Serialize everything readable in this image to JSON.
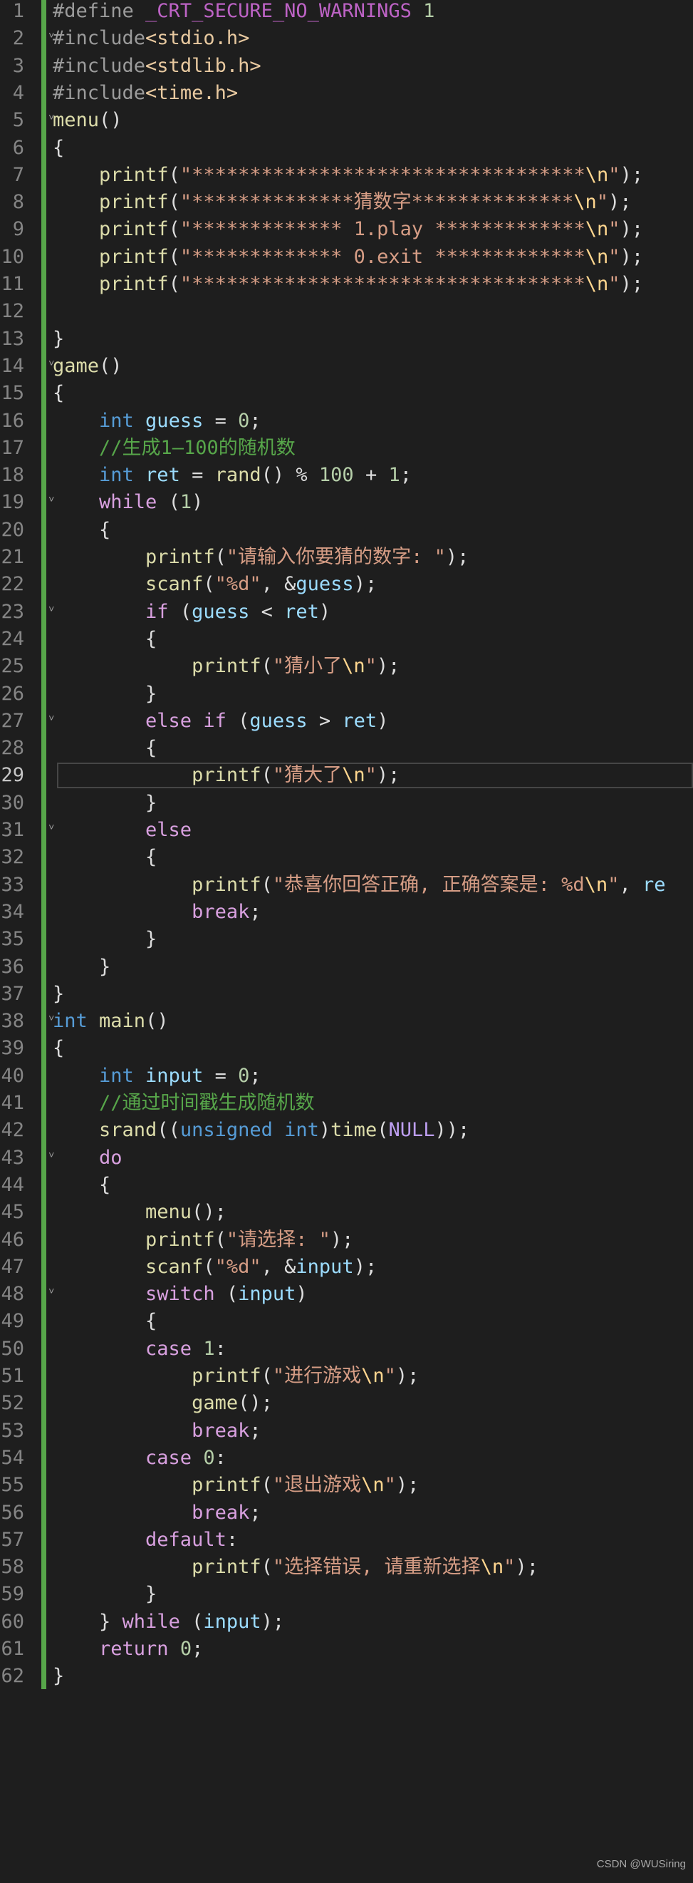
{
  "editor": {
    "current_line": 29,
    "lines": [
      [
        [
          "t-pp",
          "#define "
        ],
        [
          "t-macro",
          "_CRT_SECURE_NO_WARNINGS"
        ],
        [
          "t-num",
          " 1"
        ]
      ],
      [
        [
          "t-pp",
          "#include"
        ],
        [
          "t-inc",
          "<stdio.h>"
        ]
      ],
      [
        [
          "t-pp",
          "#include"
        ],
        [
          "t-inc",
          "<stdlib.h>"
        ]
      ],
      [
        [
          "t-pp",
          "#include"
        ],
        [
          "t-inc",
          "<time.h>"
        ]
      ],
      [
        [
          "t-fn",
          "menu"
        ],
        [
          "t-punc",
          "()"
        ]
      ],
      [
        [
          "t-punc",
          "{"
        ]
      ],
      [
        [
          "t-fn",
          "    printf"
        ],
        [
          "t-punc",
          "("
        ],
        [
          "t-str",
          "\"**********************************"
        ],
        [
          "t-esc",
          "\\n"
        ],
        [
          "t-str",
          "\""
        ],
        [
          "t-punc",
          ");"
        ]
      ],
      [
        [
          "t-fn",
          "    printf"
        ],
        [
          "t-punc",
          "("
        ],
        [
          "t-str",
          "\"**************猜数字**************"
        ],
        [
          "t-esc",
          "\\n"
        ],
        [
          "t-str",
          "\""
        ],
        [
          "t-punc",
          ");"
        ]
      ],
      [
        [
          "t-fn",
          "    printf"
        ],
        [
          "t-punc",
          "("
        ],
        [
          "t-str",
          "\"************* 1.play *************"
        ],
        [
          "t-esc",
          "\\n"
        ],
        [
          "t-str",
          "\""
        ],
        [
          "t-punc",
          ");"
        ]
      ],
      [
        [
          "t-fn",
          "    printf"
        ],
        [
          "t-punc",
          "("
        ],
        [
          "t-str",
          "\"************* 0.exit *************"
        ],
        [
          "t-esc",
          "\\n"
        ],
        [
          "t-str",
          "\""
        ],
        [
          "t-punc",
          ");"
        ]
      ],
      [
        [
          "t-fn",
          "    printf"
        ],
        [
          "t-punc",
          "("
        ],
        [
          "t-str",
          "\"**********************************"
        ],
        [
          "t-esc",
          "\\n"
        ],
        [
          "t-str",
          "\""
        ],
        [
          "t-punc",
          ");"
        ]
      ],
      [],
      [
        [
          "t-punc",
          "}"
        ]
      ],
      [
        [
          "t-fn",
          "game"
        ],
        [
          "t-punc",
          "()"
        ]
      ],
      [
        [
          "t-punc",
          "{"
        ]
      ],
      [
        [
          "t-kw",
          "    int"
        ],
        [
          "t-var",
          " guess"
        ],
        [
          "t-punc",
          " = "
        ],
        [
          "t-num",
          "0"
        ],
        [
          "t-punc",
          ";"
        ]
      ],
      [
        [
          "t-cmt",
          "    //生成1—100的随机数"
        ]
      ],
      [
        [
          "t-kw",
          "    int"
        ],
        [
          "t-var",
          " ret"
        ],
        [
          "t-punc",
          " = "
        ],
        [
          "t-fn",
          "rand"
        ],
        [
          "t-punc",
          "() % "
        ],
        [
          "t-num",
          "100"
        ],
        [
          "t-punc",
          " + "
        ],
        [
          "t-num",
          "1"
        ],
        [
          "t-punc",
          ";"
        ]
      ],
      [
        [
          "t-ctrl",
          "    while"
        ],
        [
          "t-punc",
          " ("
        ],
        [
          "t-num",
          "1"
        ],
        [
          "t-punc",
          ")"
        ]
      ],
      [
        [
          "t-punc",
          "    {"
        ]
      ],
      [
        [
          "t-fn",
          "        printf"
        ],
        [
          "t-punc",
          "("
        ],
        [
          "t-str",
          "\"请输入你要猜的数字: \""
        ],
        [
          "t-punc",
          ");"
        ]
      ],
      [
        [
          "t-fn",
          "        scanf"
        ],
        [
          "t-punc",
          "("
        ],
        [
          "t-str",
          "\"%d\""
        ],
        [
          "t-punc",
          ", &"
        ],
        [
          "t-var",
          "guess"
        ],
        [
          "t-punc",
          ");"
        ]
      ],
      [
        [
          "t-ctrl",
          "        if"
        ],
        [
          "t-punc",
          " ("
        ],
        [
          "t-var",
          "guess"
        ],
        [
          "t-punc",
          " < "
        ],
        [
          "t-var",
          "ret"
        ],
        [
          "t-punc",
          ")"
        ]
      ],
      [
        [
          "t-punc",
          "        {"
        ]
      ],
      [
        [
          "t-fn",
          "            printf"
        ],
        [
          "t-punc",
          "("
        ],
        [
          "t-str",
          "\"猜小了"
        ],
        [
          "t-esc",
          "\\n"
        ],
        [
          "t-str",
          "\""
        ],
        [
          "t-punc",
          ");"
        ]
      ],
      [
        [
          "t-punc",
          "        }"
        ]
      ],
      [
        [
          "t-ctrl",
          "        else if"
        ],
        [
          "t-punc",
          " ("
        ],
        [
          "t-var",
          "guess"
        ],
        [
          "t-punc",
          " > "
        ],
        [
          "t-var",
          "ret"
        ],
        [
          "t-punc",
          ")"
        ]
      ],
      [
        [
          "t-punc",
          "        {"
        ]
      ],
      [
        [
          "t-fn",
          "            printf"
        ],
        [
          "t-punc",
          "("
        ],
        [
          "t-str",
          "\"猜大了"
        ],
        [
          "t-esc",
          "\\n"
        ],
        [
          "t-str",
          "\""
        ],
        [
          "t-punc",
          ");"
        ]
      ],
      [
        [
          "t-punc",
          "        }"
        ]
      ],
      [
        [
          "t-ctrl",
          "        else"
        ]
      ],
      [
        [
          "t-punc",
          "        {"
        ]
      ],
      [
        [
          "t-fn",
          "            printf"
        ],
        [
          "t-punc",
          "("
        ],
        [
          "t-str",
          "\"恭喜你回答正确, 正确答案是: %d"
        ],
        [
          "t-esc",
          "\\n"
        ],
        [
          "t-str",
          "\""
        ],
        [
          "t-punc",
          ", "
        ],
        [
          "t-var",
          "re"
        ]
      ],
      [
        [
          "t-ctrl",
          "            break"
        ],
        [
          "t-punc",
          ";"
        ]
      ],
      [
        [
          "t-punc",
          "        }"
        ]
      ],
      [
        [
          "t-punc",
          "    }"
        ]
      ],
      [
        [
          "t-punc",
          "}"
        ]
      ],
      [
        [
          "t-kw",
          "int"
        ],
        [
          "t-fn",
          " main"
        ],
        [
          "t-punc",
          "()"
        ]
      ],
      [
        [
          "t-punc",
          "{"
        ]
      ],
      [
        [
          "t-kw",
          "    int"
        ],
        [
          "t-var",
          " input"
        ],
        [
          "t-punc",
          " = "
        ],
        [
          "t-num",
          "0"
        ],
        [
          "t-punc",
          ";"
        ]
      ],
      [
        [
          "t-cmt",
          "    //通过时间戳生成随机数"
        ]
      ],
      [
        [
          "t-fn",
          "    srand"
        ],
        [
          "t-punc",
          "(("
        ],
        [
          "t-kw",
          "unsigned int"
        ],
        [
          "t-punc",
          ")"
        ],
        [
          "t-fn",
          "time"
        ],
        [
          "t-punc",
          "("
        ],
        [
          "t-null",
          "NULL"
        ],
        [
          "t-punc",
          "));"
        ]
      ],
      [
        [
          "t-ctrl",
          "    do"
        ]
      ],
      [
        [
          "t-punc",
          "    {"
        ]
      ],
      [
        [
          "t-fn",
          "        menu"
        ],
        [
          "t-punc",
          "();"
        ]
      ],
      [
        [
          "t-fn",
          "        printf"
        ],
        [
          "t-punc",
          "("
        ],
        [
          "t-str",
          "\"请选择: \""
        ],
        [
          "t-punc",
          ");"
        ]
      ],
      [
        [
          "t-fn",
          "        scanf"
        ],
        [
          "t-punc",
          "("
        ],
        [
          "t-str",
          "\"%d\""
        ],
        [
          "t-punc",
          ", &"
        ],
        [
          "t-var",
          "input"
        ],
        [
          "t-punc",
          ");"
        ]
      ],
      [
        [
          "t-ctrl",
          "        switch"
        ],
        [
          "t-punc",
          " ("
        ],
        [
          "t-var",
          "input"
        ],
        [
          "t-punc",
          ")"
        ]
      ],
      [
        [
          "t-punc",
          "        {"
        ]
      ],
      [
        [
          "t-ctrl",
          "        case"
        ],
        [
          "t-num",
          " 1"
        ],
        [
          "t-punc",
          ":"
        ]
      ],
      [
        [
          "t-fn",
          "            printf"
        ],
        [
          "t-punc",
          "("
        ],
        [
          "t-str",
          "\"进行游戏"
        ],
        [
          "t-esc",
          "\\n"
        ],
        [
          "t-str",
          "\""
        ],
        [
          "t-punc",
          ");"
        ]
      ],
      [
        [
          "t-fn",
          "            game"
        ],
        [
          "t-punc",
          "();"
        ]
      ],
      [
        [
          "t-ctrl",
          "            break"
        ],
        [
          "t-punc",
          ";"
        ]
      ],
      [
        [
          "t-ctrl",
          "        case"
        ],
        [
          "t-num",
          " 0"
        ],
        [
          "t-punc",
          ":"
        ]
      ],
      [
        [
          "t-fn",
          "            printf"
        ],
        [
          "t-punc",
          "("
        ],
        [
          "t-str",
          "\"退出游戏"
        ],
        [
          "t-esc",
          "\\n"
        ],
        [
          "t-str",
          "\""
        ],
        [
          "t-punc",
          ");"
        ]
      ],
      [
        [
          "t-ctrl",
          "            break"
        ],
        [
          "t-punc",
          ";"
        ]
      ],
      [
        [
          "t-ctrl",
          "        default"
        ],
        [
          "t-punc",
          ":"
        ]
      ],
      [
        [
          "t-fn",
          "            printf"
        ],
        [
          "t-punc",
          "("
        ],
        [
          "t-str",
          "\"选择错误, 请重新选择"
        ],
        [
          "t-esc",
          "\\n"
        ],
        [
          "t-str",
          "\""
        ],
        [
          "t-punc",
          ");"
        ]
      ],
      [
        [
          "t-punc",
          "        }"
        ]
      ],
      [
        [
          "t-punc",
          "    } "
        ],
        [
          "t-ctrl",
          "while"
        ],
        [
          "t-punc",
          " ("
        ],
        [
          "t-var",
          "input"
        ],
        [
          "t-punc",
          ");"
        ]
      ],
      [
        [
          "t-ctrl",
          "    return"
        ],
        [
          "t-num",
          " 0"
        ],
        [
          "t-punc",
          ";"
        ]
      ],
      [
        [
          "t-punc",
          "}"
        ]
      ]
    ],
    "fold_lines": [
      2,
      5,
      14,
      19,
      23,
      27,
      31,
      38,
      43,
      48
    ]
  },
  "watermark": "CSDN @WUSiring"
}
